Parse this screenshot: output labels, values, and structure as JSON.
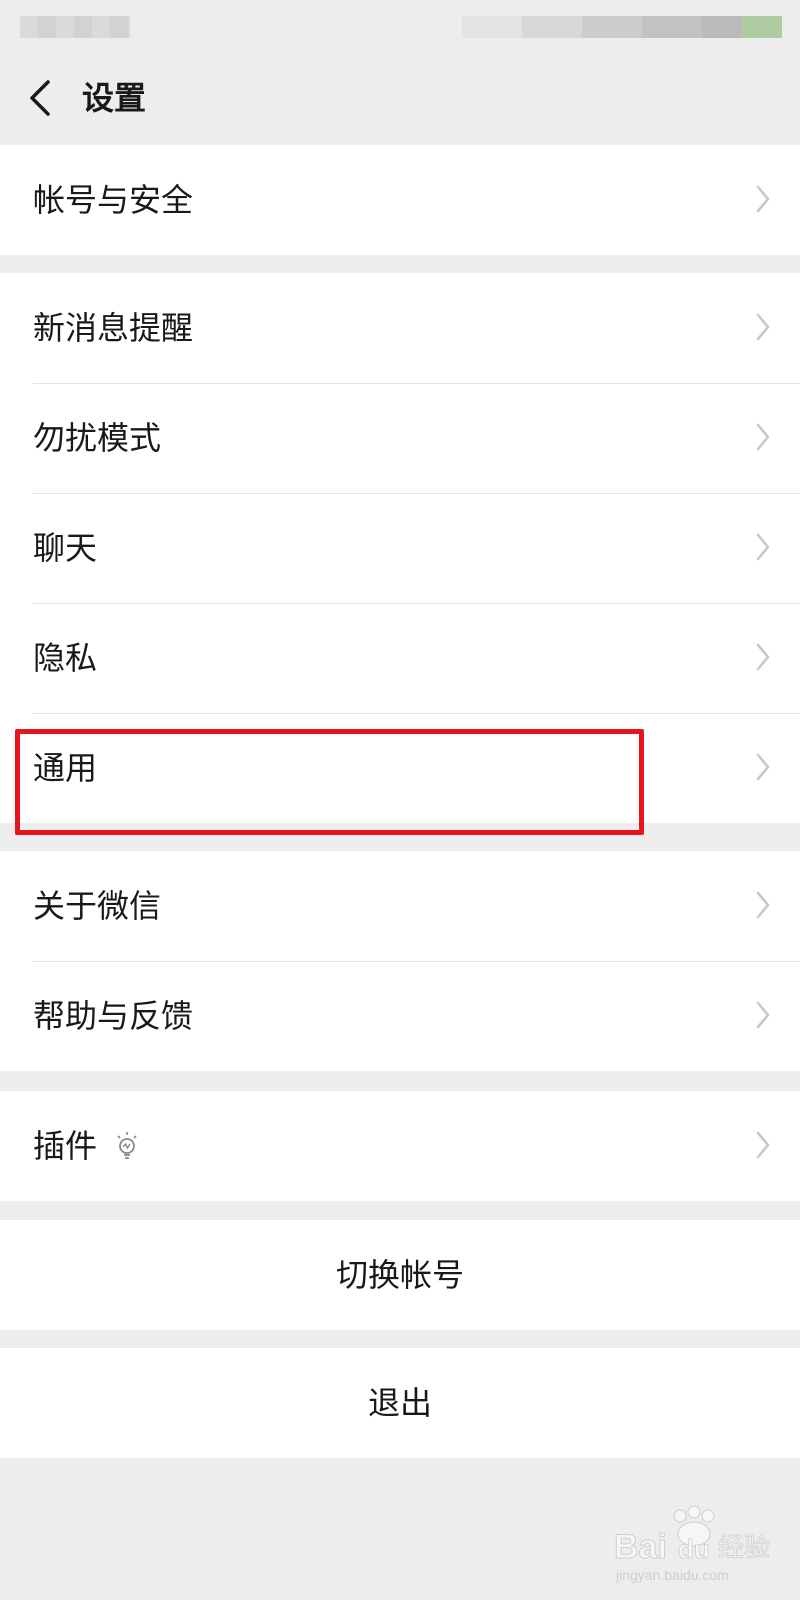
{
  "nav": {
    "title": "设置"
  },
  "groups": [
    {
      "items": [
        {
          "label": "帐号与安全"
        }
      ]
    },
    {
      "items": [
        {
          "label": "新消息提醒"
        },
        {
          "label": "勿扰模式"
        },
        {
          "label": "聊天"
        },
        {
          "label": "隐私"
        },
        {
          "label": "通用"
        }
      ]
    },
    {
      "items": [
        {
          "label": "关于微信"
        },
        {
          "label": "帮助与反馈"
        }
      ]
    },
    {
      "items": [
        {
          "label": "插件",
          "icon": "lightbulb-icon"
        }
      ]
    }
  ],
  "actions": {
    "switch_account": "切换帐号",
    "logout": "退出"
  },
  "highlight": {
    "target": "通用",
    "color": "#e8141b"
  },
  "watermark": {
    "brand": "Baidu经验",
    "url": "jingyan.baidu.com"
  }
}
